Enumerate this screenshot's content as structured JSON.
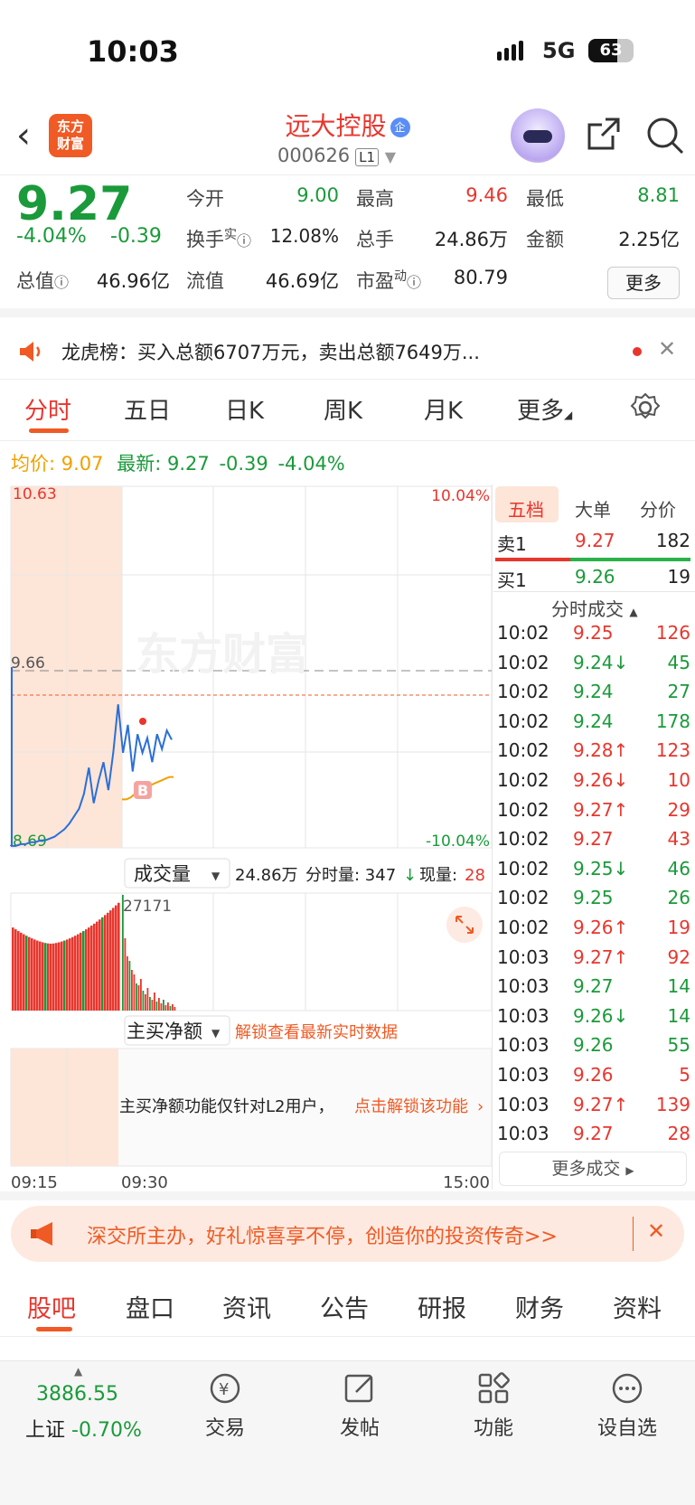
{
  "status": {
    "time": "10:03",
    "network": "5G",
    "battery": "63"
  },
  "header": {
    "logo_line1": "东方",
    "logo_line2": "财富",
    "stock_name": "远大控股",
    "badge": "企",
    "code": "000626",
    "level": "L1"
  },
  "quote": {
    "price": "9.27",
    "change_pct": "-4.04%",
    "change": "-0.39",
    "open_label": "今开",
    "open": "9.00",
    "high_label": "最高",
    "high": "9.46",
    "low_label": "最低",
    "low": "8.81",
    "turnover_label": "换手",
    "turnover_sup": "实",
    "turnover": "12.08%",
    "volume_label": "总手",
    "volume": "24.86万",
    "amount_label": "金额",
    "amount": "2.25亿",
    "mcap_label": "总值",
    "mcap": "46.96亿",
    "float_label": "流值",
    "float": "46.69亿",
    "pe_label": "市盈",
    "pe_sup": "动",
    "pe": "80.79",
    "more": "更多"
  },
  "notice": {
    "text": "龙虎榜：买入总额6707万元，卖出总额7649万..."
  },
  "tabs": [
    "分时",
    "五日",
    "日K",
    "周K",
    "月K",
    "更多"
  ],
  "info": {
    "avg_label": "均价:",
    "avg": "9.07",
    "latest_label": "最新:",
    "latest": "9.27",
    "change": "-0.39",
    "change_pct": "-4.04%"
  },
  "chart_data": {
    "type": "line",
    "x": [
      "09:15",
      "09:30",
      "15:00"
    ],
    "price_top": "10.63",
    "price_bottom": "8.69",
    "pct_top": "10.04%",
    "pct_bottom": "-10.04%",
    "ref_price": "9.66",
    "ylim": [
      8.69,
      10.63
    ],
    "series": [
      {
        "values": [
          8.7,
          8.7,
          8.71,
          8.71,
          8.72,
          8.72,
          8.73,
          8.73,
          8.74,
          8.75,
          8.77,
          8.79,
          8.82,
          8.86,
          8.9,
          8.98,
          9.12,
          8.93,
          9.05,
          9.15,
          9.0,
          9.2,
          9.46,
          9.2,
          9.35,
          9.1,
          9.3,
          9.2,
          9.28,
          9.15,
          9.3,
          9.22,
          9.32,
          9.27
        ]
      },
      {
        "values": [
          8.95,
          8.95,
          8.96,
          8.98,
          9.0,
          9.01,
          9.02,
          9.03,
          9.04,
          9.05,
          9.06,
          9.07,
          9.07
        ]
      }
    ],
    "buy_marker": "B",
    "volume_label": "成交量",
    "volume_total": "24.86万",
    "volume_detail": "分时量: 347",
    "volume_now_label": "现量:",
    "volume_now": "28",
    "volume_max": "27171",
    "net_label": "主买净额",
    "unlock": "解锁查看最新实时数据",
    "l2_text": "主买净额功能仅针对L2用户，",
    "l2_link": "点击解锁该功能"
  },
  "depth": {
    "tabs": [
      "五档",
      "大单",
      "分价"
    ],
    "sell1": {
      "label": "卖1",
      "price": "9.27",
      "vol": "182"
    },
    "buy1": {
      "label": "买1",
      "price": "9.26",
      "vol": "19"
    },
    "ticks_title": "分时成交",
    "ticks": [
      {
        "t": "10:02",
        "p": "9.25",
        "a": "",
        "v": "126",
        "c": "red"
      },
      {
        "t": "10:02",
        "p": "9.24",
        "a": "↓",
        "v": "45",
        "c": "green"
      },
      {
        "t": "10:02",
        "p": "9.24",
        "a": "",
        "v": "27",
        "c": "green"
      },
      {
        "t": "10:02",
        "p": "9.24",
        "a": "",
        "v": "178",
        "c": "green"
      },
      {
        "t": "10:02",
        "p": "9.28",
        "a": "↑",
        "v": "123",
        "c": "red"
      },
      {
        "t": "10:02",
        "p": "9.26",
        "a": "↓",
        "v": "10",
        "c": "red"
      },
      {
        "t": "10:02",
        "p": "9.27",
        "a": "↑",
        "v": "29",
        "c": "red"
      },
      {
        "t": "10:02",
        "p": "9.27",
        "a": "",
        "v": "43",
        "c": "red"
      },
      {
        "t": "10:02",
        "p": "9.25",
        "a": "↓",
        "v": "46",
        "c": "green"
      },
      {
        "t": "10:02",
        "p": "9.25",
        "a": "",
        "v": "26",
        "c": "green"
      },
      {
        "t": "10:02",
        "p": "9.26",
        "a": "↑",
        "v": "19",
        "c": "red"
      },
      {
        "t": "10:03",
        "p": "9.27",
        "a": "↑",
        "v": "92",
        "c": "red"
      },
      {
        "t": "10:03",
        "p": "9.27",
        "a": "",
        "v": "14",
        "c": "green"
      },
      {
        "t": "10:03",
        "p": "9.26",
        "a": "↓",
        "v": "14",
        "c": "green"
      },
      {
        "t": "10:03",
        "p": "9.26",
        "a": "",
        "v": "55",
        "c": "green"
      },
      {
        "t": "10:03",
        "p": "9.26",
        "a": "",
        "v": "5",
        "c": "red"
      },
      {
        "t": "10:03",
        "p": "9.27",
        "a": "↑",
        "v": "139",
        "c": "red"
      },
      {
        "t": "10:03",
        "p": "9.27",
        "a": "",
        "v": "28",
        "c": "red"
      }
    ],
    "more": "更多成交"
  },
  "ad": {
    "text": "深交所主办，好礼惊喜享不停，创造你的投资传奇>>"
  },
  "bottom_tabs": [
    "股吧",
    "盘口",
    "资讯",
    "公告",
    "研报",
    "财务",
    "资料"
  ],
  "footer": {
    "index_value": "3886.55",
    "index_name": "上证",
    "index_change": "-0.70%",
    "trade": "交易",
    "post": "发帖",
    "func": "功能",
    "watch": "设自选"
  },
  "colors": {
    "up": "#e8362d",
    "down": "#1a9a3a",
    "accent": "#f05a24",
    "avg": "#f0a000"
  }
}
